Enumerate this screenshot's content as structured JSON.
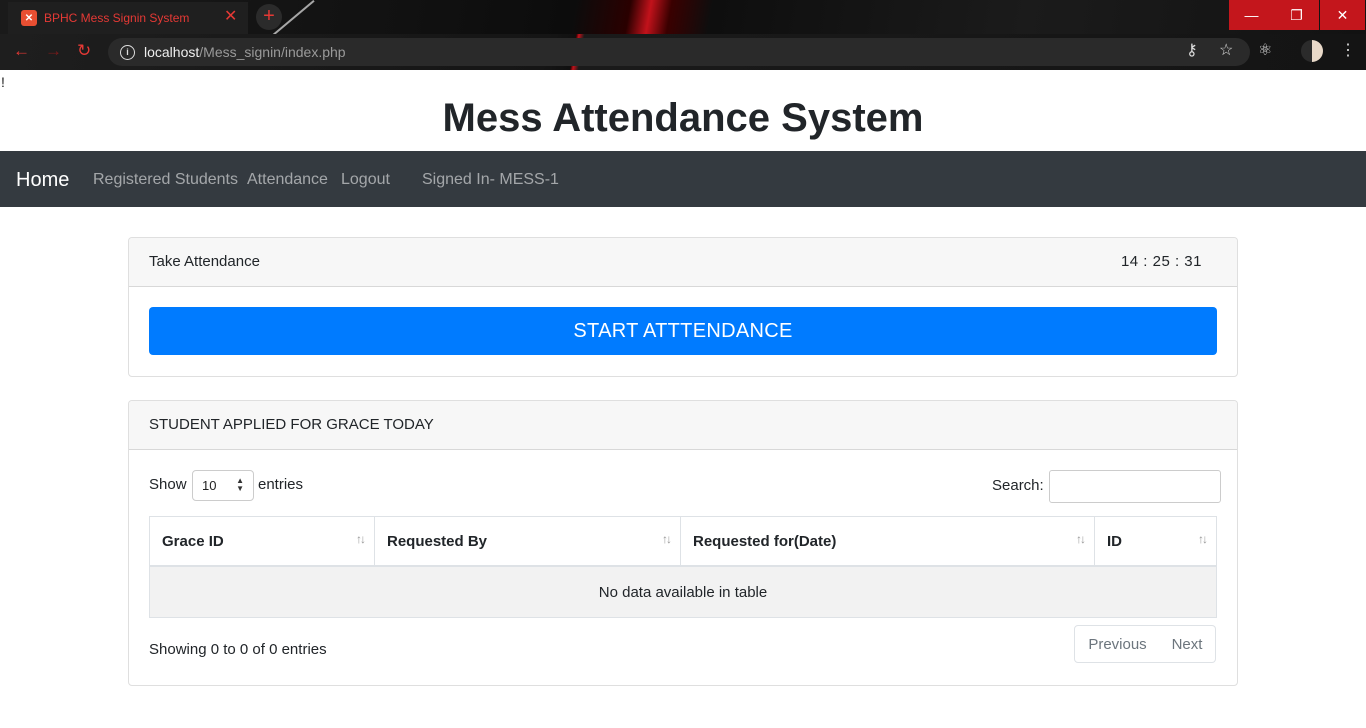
{
  "browser": {
    "tab_title": "BPHC Mess Signin System",
    "favicon": "xampp-icon",
    "url_host": "localhost",
    "url_path": "/Mess_signin/index.php",
    "accent_color": "#e53935"
  },
  "page": {
    "stray_text": "!",
    "title": "Mess Attendance System"
  },
  "navbar": {
    "brand": "Home",
    "links": [
      "Registered Students",
      "Attendance",
      "Logout"
    ],
    "signed_in": "Signed In- MESS-1"
  },
  "attendance_card": {
    "header": "Take Attendance",
    "clock": "14 : 25 : 31",
    "start_button": "START ATTTENDANCE"
  },
  "grace_card": {
    "header": "STUDENT APPLIED FOR GRACE TODAY",
    "show_label": "Show",
    "entries_value": "10",
    "entries_label": "entries",
    "search_label": "Search:",
    "search_value": "",
    "columns": [
      "Grace ID",
      "Requested By",
      "Requested for(Date)",
      "ID"
    ],
    "empty_message": "No data available in table",
    "info": "Showing 0 to 0 of 0 entries",
    "previous": "Previous",
    "next": "Next"
  },
  "colors": {
    "primary": "#007bff",
    "navbar": "#343a40"
  }
}
